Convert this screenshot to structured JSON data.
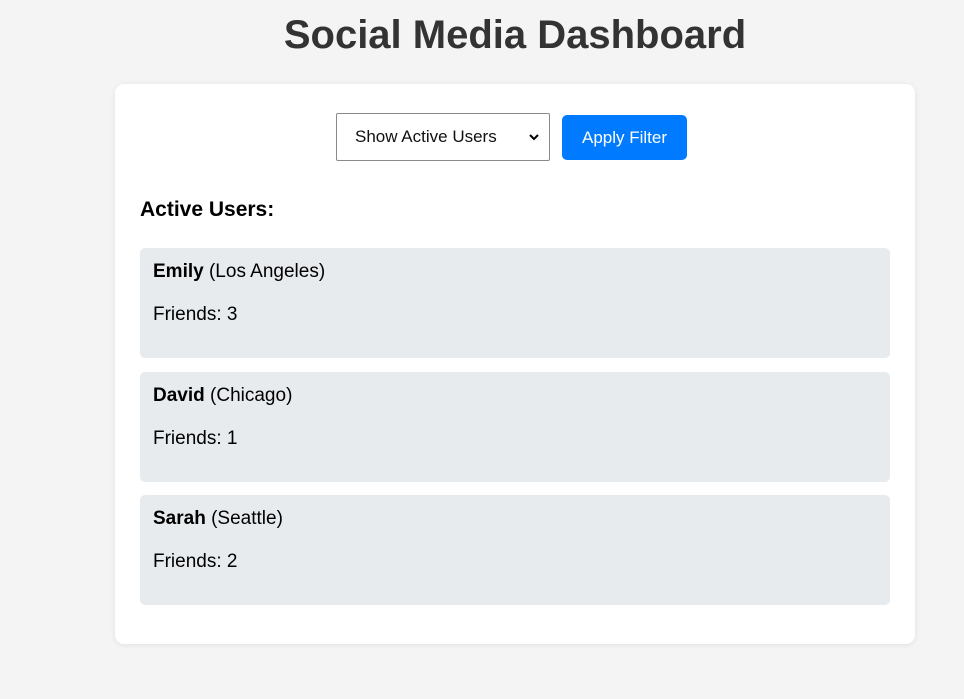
{
  "header": {
    "title": "Social Media Dashboard"
  },
  "filter": {
    "selected_option": "Show Active Users",
    "apply_label": "Apply Filter"
  },
  "section": {
    "heading": "Active Users:"
  },
  "users": [
    {
      "name": "Emily",
      "location": "(Los Angeles)",
      "friends": "Friends: 3"
    },
    {
      "name": "David",
      "location": "(Chicago)",
      "friends": "Friends: 1"
    },
    {
      "name": "Sarah",
      "location": "(Seattle)",
      "friends": "Friends: 2"
    }
  ],
  "icons": {
    "select": "chevron-down-icon"
  },
  "colors": {
    "accent": "#007bff",
    "card_bg": "#e8ebee",
    "page_bg": "#f4f4f4"
  }
}
